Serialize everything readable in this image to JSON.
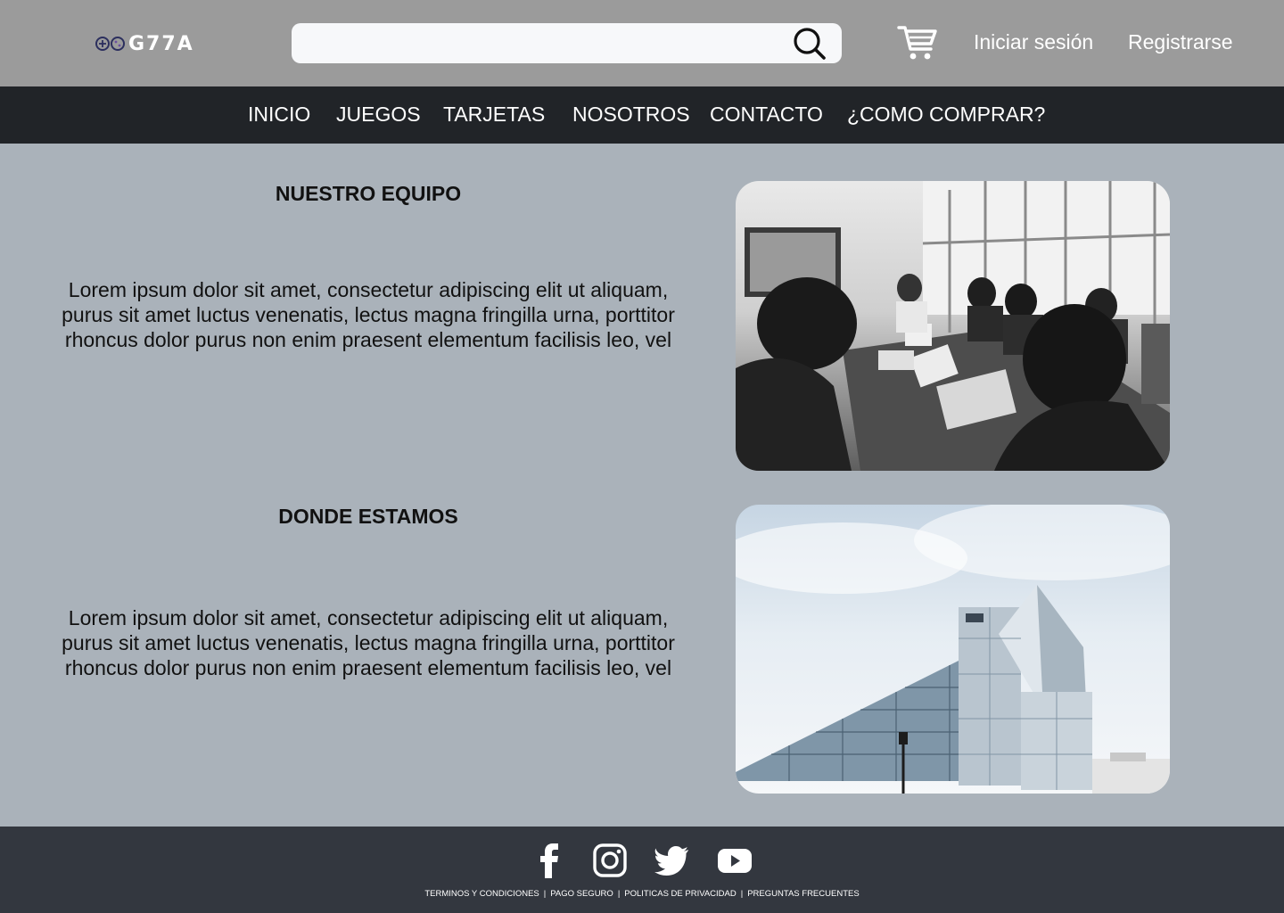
{
  "header": {
    "logo_text": "G77A",
    "search": {
      "placeholder": "",
      "icon": "search-icon"
    },
    "cart_icon": "cart-icon",
    "login_label": "Iniciar sesión",
    "register_label": "Registrarse",
    "colors": {
      "background": "#9b9b9b",
      "search_bg": "#f7f8fa"
    }
  },
  "nav": {
    "items": [
      {
        "label": "INICIO"
      },
      {
        "label": "JUEGOS"
      },
      {
        "label": "TARJETAS"
      },
      {
        "label": "NOSOTROS"
      },
      {
        "label": "CONTACTO"
      },
      {
        "label": "¿COMO COMPRAR?"
      }
    ],
    "colors": {
      "background": "#212428"
    }
  },
  "main": {
    "background": "#aab2ba",
    "sections": [
      {
        "title": "NUESTRO EQUIPO",
        "body": "Lorem ipsum dolor sit amet, consectetur adipiscing elit ut aliquam, purus sit amet luctus venenatis, lectus magna fringilla urna, porttitor rhoncus dolor purus non enim praesent elementum facilisis leo, vel",
        "image": "team-meeting-photo"
      },
      {
        "title": "DONDE ESTAMOS",
        "body": "Lorem ipsum dolor sit amet, consectetur adipiscing elit ut aliquam, purus sit amet luctus venenatis, lectus magna fringilla urna, porttitor rhoncus dolor purus non enim praesent elementum facilisis leo, vel",
        "image": "office-building-photo"
      }
    ]
  },
  "footer": {
    "background": "#33373f",
    "social": [
      "facebook-icon",
      "instagram-icon",
      "twitter-icon",
      "youtube-icon"
    ],
    "links": [
      {
        "label": "TERMINOS Y CONDICIONES"
      },
      {
        "label": "PAGO SEGURO"
      },
      {
        "label": "POLITICAS DE PRIVACIDAD"
      },
      {
        "label": "PREGUNTAS FRECUENTES"
      }
    ],
    "separator": "|"
  }
}
